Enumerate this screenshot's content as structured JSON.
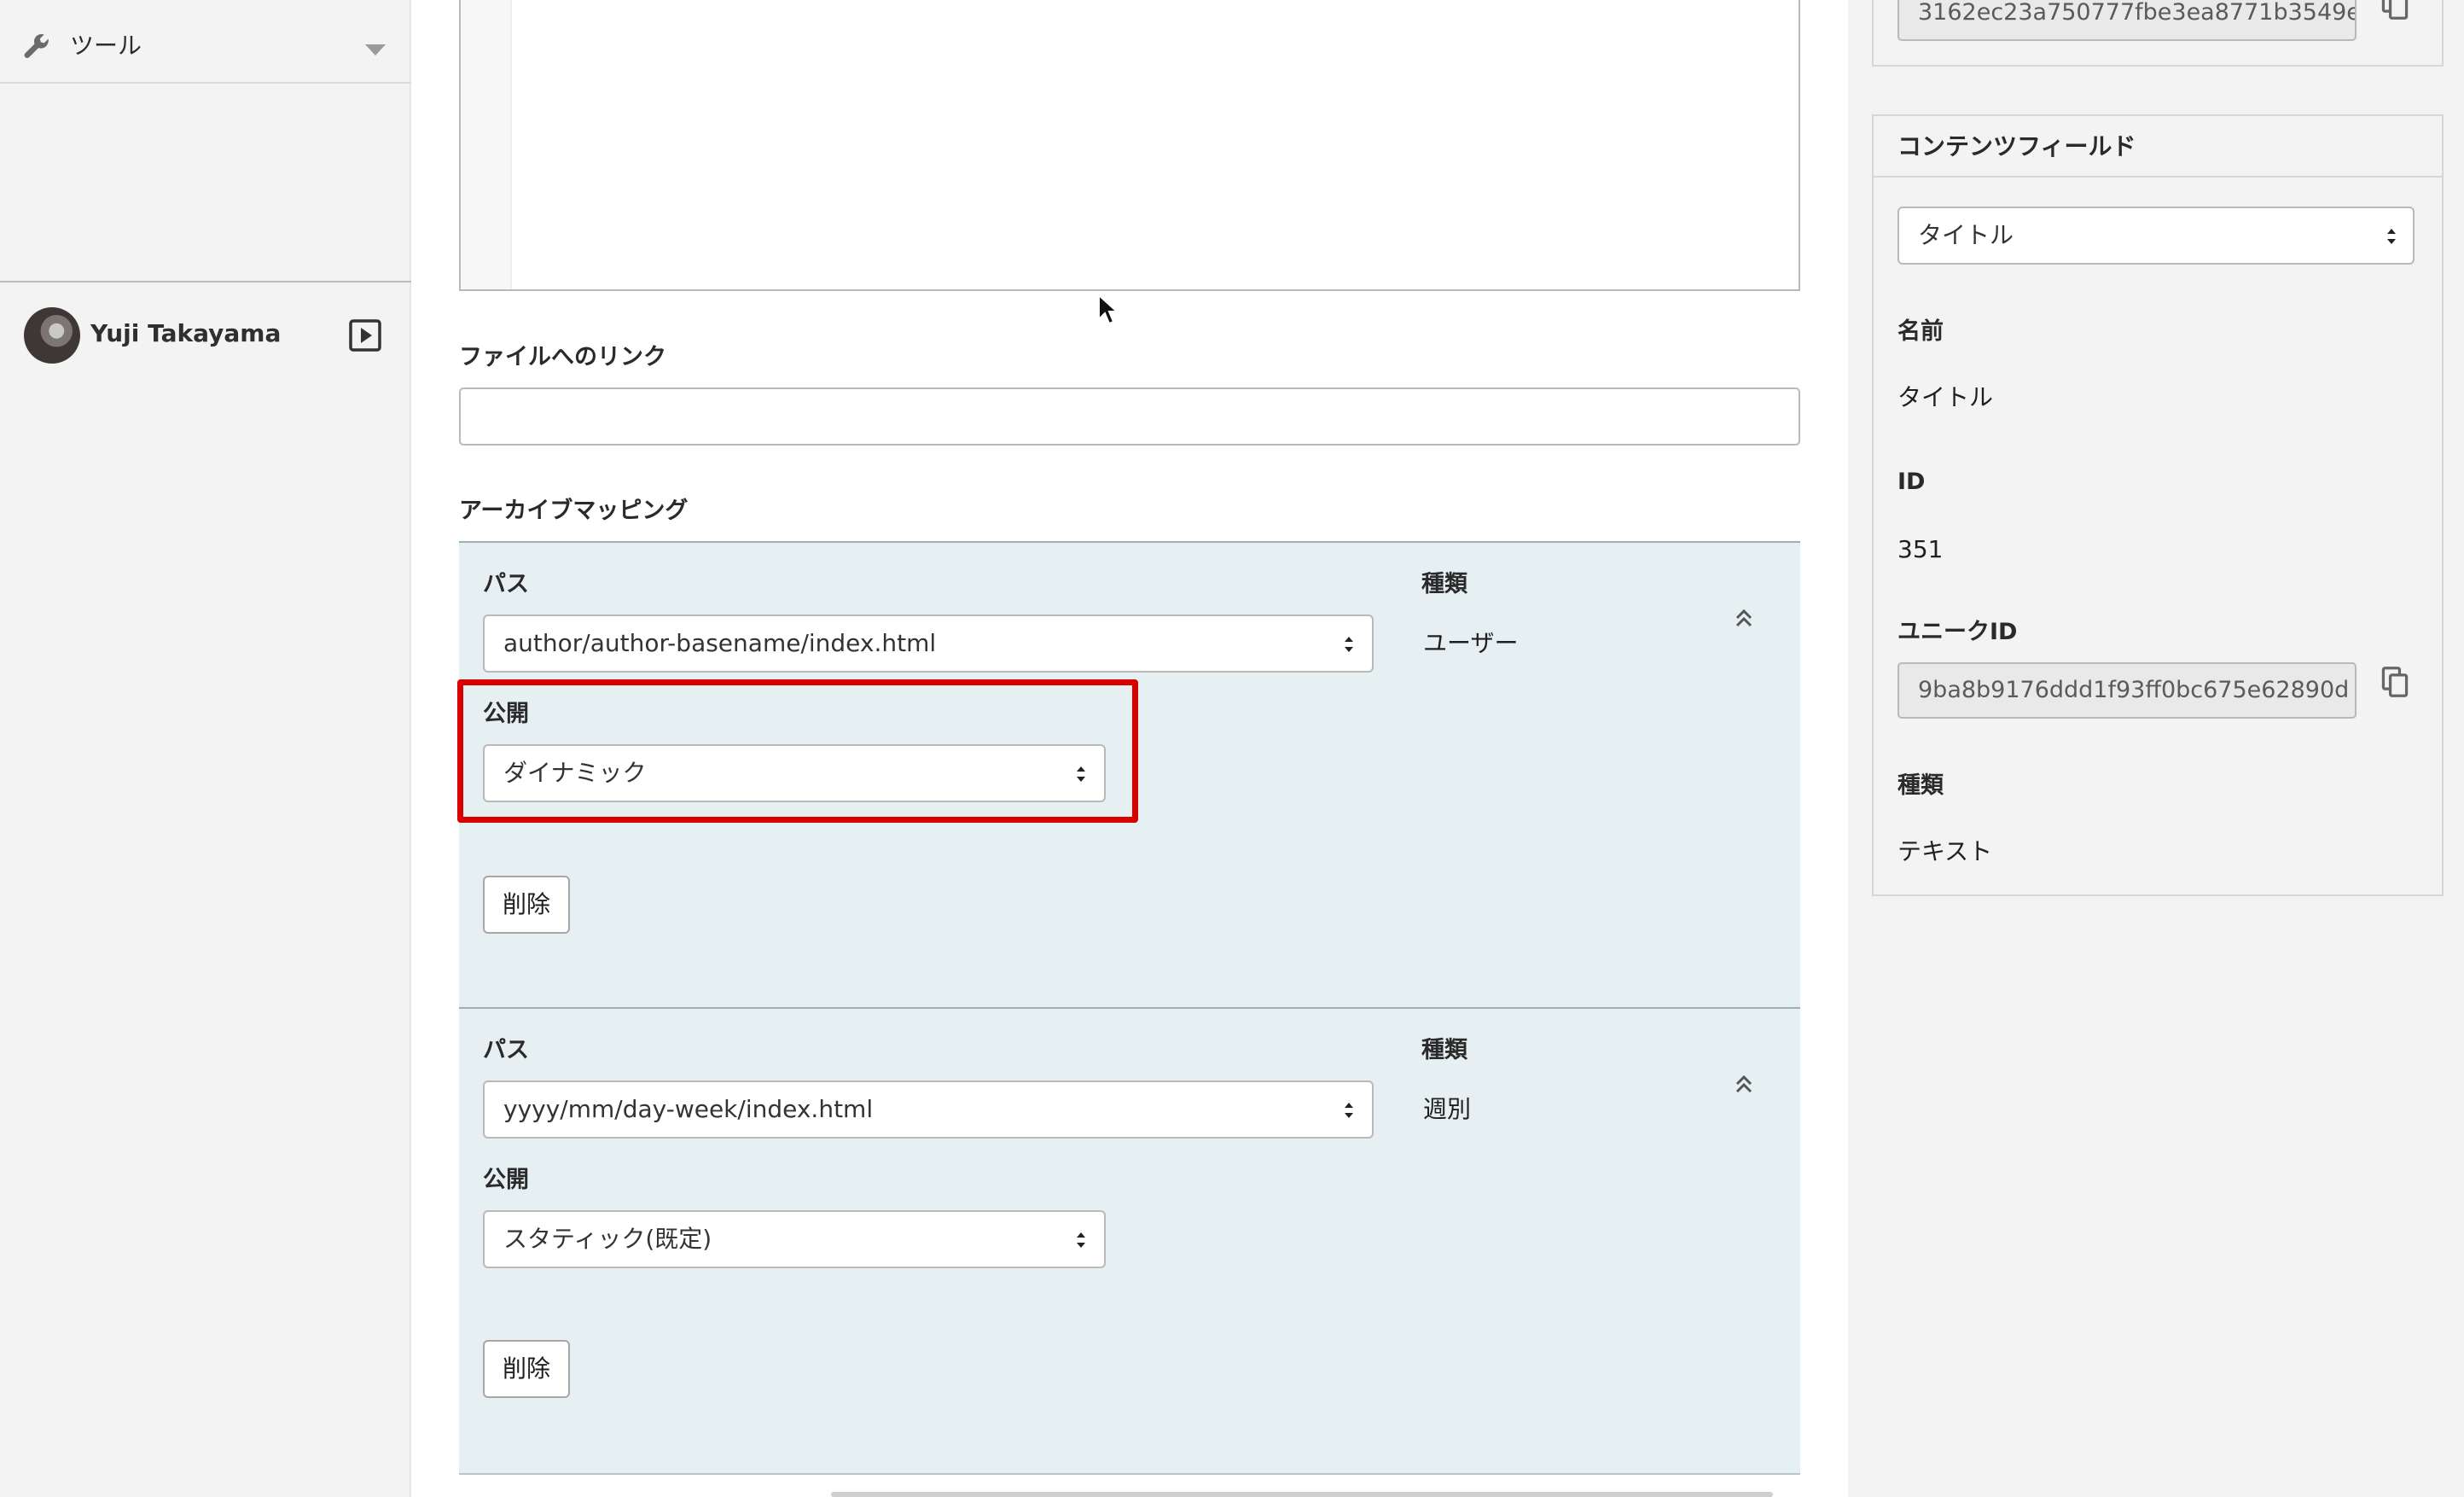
{
  "sidebar": {
    "tools_label": "ツール",
    "user_name": "Yuji Takayama"
  },
  "main": {
    "file_link_label": "ファイルへのリンク",
    "file_link_value": "",
    "archive_mapping_label": "アーカイブマッピング",
    "mappings": [
      {
        "path_label": "パス",
        "path_value": "author/author-basename/index.html",
        "type_label": "種類",
        "type_value": "ユーザー",
        "publish_label": "公開",
        "publish_value": "ダイナミック",
        "delete_label": "削除"
      },
      {
        "path_label": "パス",
        "path_value": "yyyy/mm/day-week/index.html",
        "type_label": "種類",
        "type_value": "週別",
        "publish_label": "公開",
        "publish_value": "スタティック(既定)",
        "delete_label": "削除"
      }
    ]
  },
  "right": {
    "top_id_value": "3162ec23a750777fbe3ea8771b3549e",
    "content_field": {
      "title": "コンテンツフィールド",
      "select_value": "タイトル",
      "name_label": "名前",
      "name_value": "タイトル",
      "id_label": "ID",
      "id_value": "351",
      "unique_id_label": "ユニークID",
      "unique_id_value": "9ba8b9176ddd1f93ff0bc675e62890d",
      "type_label": "種類",
      "type_value": "テキスト"
    }
  },
  "icons": {
    "tools": "wrench-icon",
    "dropdown": "chevron-down-icon",
    "logout": "play-box-icon",
    "select": "select-arrows-icon",
    "collapse": "double-chevron-up-icon",
    "copy": "copy-icon",
    "cursor": "mouse-pointer-icon"
  },
  "colors": {
    "highlight": "#d90000",
    "panel_bg": "#e6f0f2",
    "sidebar_bg": "#f3f3f3"
  }
}
